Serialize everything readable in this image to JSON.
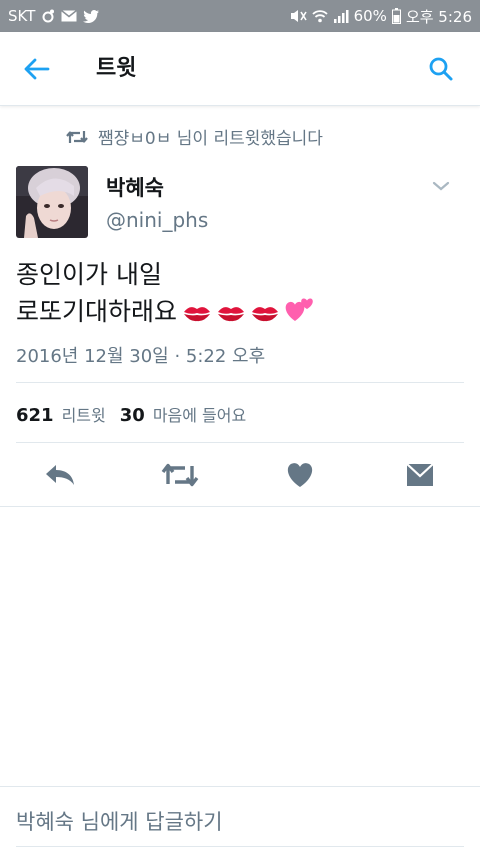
{
  "status_bar": {
    "carrier": "SKT",
    "battery": "60%",
    "time": "오후 5:26"
  },
  "header": {
    "title": "트윗"
  },
  "retweet_context": {
    "text": "쨈쟝ㅂ0ㅂ 님이 리트윗했습니다"
  },
  "author": {
    "name": "박혜숙",
    "handle": "@nini_phs"
  },
  "tweet": {
    "line1": "종인이가 내일",
    "line2": "로또기대하래요",
    "timestamp": "2016년 12월 30일 · 5:22 오후"
  },
  "stats": {
    "retweets_count": "621",
    "retweets_label": "리트윗",
    "likes_count": "30",
    "likes_label": "마음에 들어요"
  },
  "reply": {
    "placeholder": "박혜숙 님에게 답글하기"
  },
  "icons": {
    "back": "arrow-left-icon",
    "search": "search-icon",
    "retweet": "retweet-icon",
    "caret": "chevron-down-icon",
    "reply": "reply-icon",
    "like": "heart-icon",
    "message": "envelope-icon"
  },
  "colors": {
    "accent": "#1da1f2",
    "text_secondary": "#657786",
    "icon_gray": "#657786",
    "status_bar": "#8a9096"
  }
}
